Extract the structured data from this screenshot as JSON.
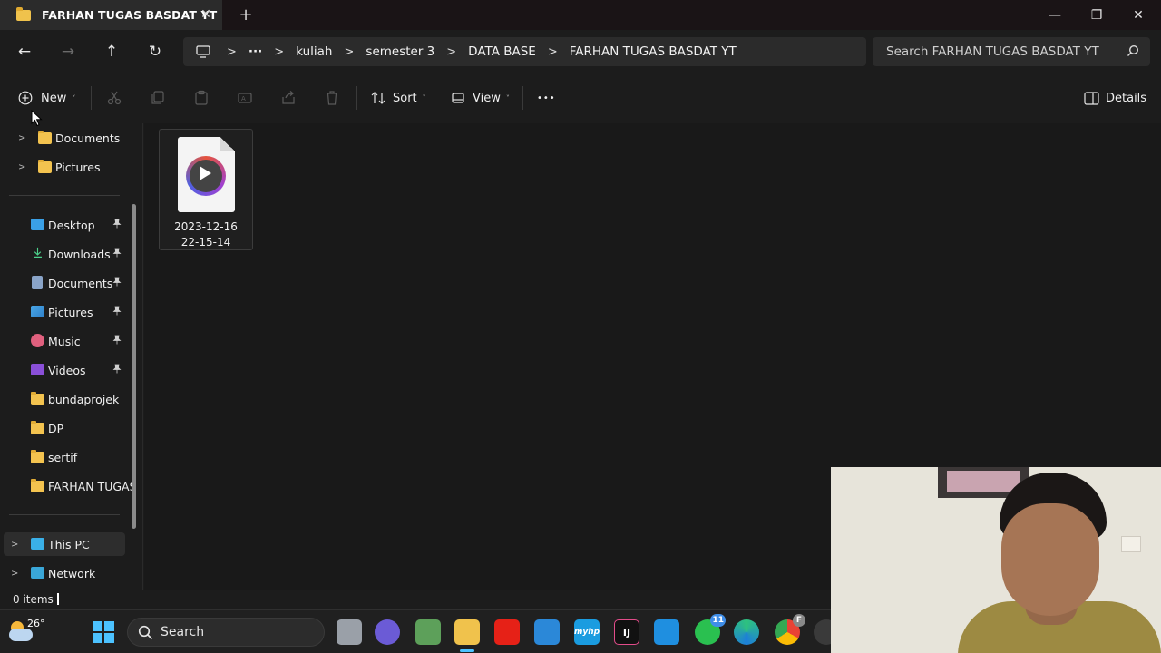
{
  "window": {
    "tab_title": "FARHAN TUGAS BASDAT YT",
    "close_tab_glyph": "✕",
    "new_tab_glyph": "+",
    "minimize_glyph": "—",
    "restore_glyph": "❐",
    "close_glyph": "✕"
  },
  "nav": {
    "back_glyph": "←",
    "forward_glyph": "→",
    "up_glyph": "↑",
    "refresh_glyph": "↻"
  },
  "breadcrumb": {
    "more_glyph": "···",
    "separator": ">",
    "items": [
      "kuliah",
      "semester 3",
      "DATA BASE",
      "FARHAN TUGAS BASDAT YT"
    ]
  },
  "search": {
    "placeholder": "Search FARHAN TUGAS BASDAT YT"
  },
  "toolbar": {
    "new_label": "New",
    "sort_label": "Sort",
    "view_label": "View",
    "more_glyph": "•••",
    "details_label": "Details",
    "chevron_glyph": "˅"
  },
  "sidebar": {
    "top_items": [
      {
        "label": "Documents",
        "icon": "folder-icon"
      },
      {
        "label": "Pictures",
        "icon": "folder-icon"
      }
    ],
    "quick_access": [
      {
        "label": "Desktop",
        "icon": "desktop-icon",
        "pinned": true
      },
      {
        "label": "Downloads",
        "icon": "download-icon",
        "pinned": true
      },
      {
        "label": "Documents",
        "icon": "documents-icon",
        "pinned": true
      },
      {
        "label": "Pictures",
        "icon": "pictures-icon",
        "pinned": true
      },
      {
        "label": "Music",
        "icon": "music-icon",
        "pinned": true
      },
      {
        "label": "Videos",
        "icon": "videos-icon",
        "pinned": true
      },
      {
        "label": "bundaprojek",
        "icon": "folder-icon",
        "pinned": false
      },
      {
        "label": "DP",
        "icon": "folder-icon",
        "pinned": false
      },
      {
        "label": "sertif",
        "icon": "folder-icon",
        "pinned": false
      },
      {
        "label": "FARHAN TUGAS",
        "icon": "folder-icon",
        "pinned": false
      }
    ],
    "bottom_items": [
      {
        "label": "This PC",
        "icon": "pc-icon",
        "selected": true
      },
      {
        "label": "Network",
        "icon": "network-icon",
        "selected": false
      }
    ],
    "expand_glyph": ">",
    "pin_glyph": "📌"
  },
  "files": [
    {
      "name_line1": "2023-12-16",
      "name_line2": "22-15-14",
      "type": "video-file"
    }
  ],
  "status": {
    "count": "0 items"
  },
  "taskbar": {
    "temperature": "26°",
    "search_label": "Search",
    "whatsapp_badge": "11",
    "chrome_badge": "F",
    "myhp_label": "myhp",
    "ij_label": "IJ"
  },
  "colors": {
    "accent": "#4cc2ff",
    "folder": "#f3c34f",
    "background": "#1c1c1c"
  }
}
